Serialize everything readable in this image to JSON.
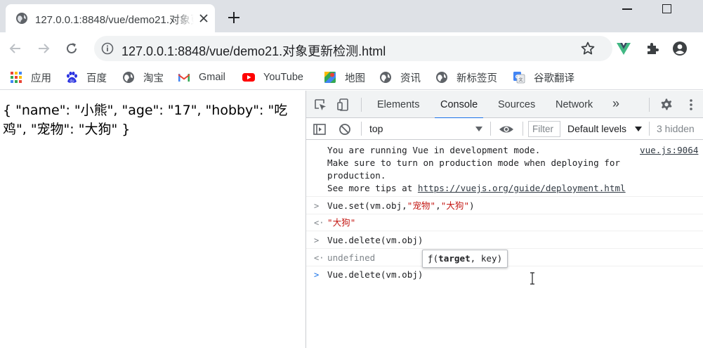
{
  "tab": {
    "title": "127.0.0.1:8848/vue/demo21.对象更新检测.html"
  },
  "omnibox": {
    "url": "127.0.0.1:8848/vue/demo21.对象更新检测.html"
  },
  "bookmarks": [
    {
      "label": "应用",
      "icon": "apps-grid-icon"
    },
    {
      "label": "百度",
      "icon": "baidu-paw-icon"
    },
    {
      "label": "淘宝",
      "icon": "globe-icon"
    },
    {
      "label": "Gmail",
      "icon": "gmail-icon"
    },
    {
      "label": "YouTube",
      "icon": "youtube-icon"
    },
    {
      "label": "地图",
      "icon": "maps-icon"
    },
    {
      "label": "资讯",
      "icon": "globe-icon"
    },
    {
      "label": "新标签页",
      "icon": "globe-icon"
    },
    {
      "label": "谷歌翻译",
      "icon": "translate-icon"
    }
  ],
  "page": {
    "content": "{ \"name\": \"小熊\", \"age\": \"17\", \"hobby\": \"吃鸡\", \"宠物\": \"大狗\" }"
  },
  "devtools": {
    "tabs": [
      "Elements",
      "Console",
      "Sources",
      "Network"
    ],
    "active_tab": "Console",
    "context": "top",
    "filter_placeholder": "Filter",
    "levels": "Default levels",
    "hidden": "3 hidden",
    "console": {
      "vue_msg_line1": "You are running Vue in development mode.",
      "vue_msg_line2": "Make sure to turn on production mode when deploying for",
      "vue_msg_line3": "production.",
      "vue_msg_line4_prefix": "See more tips at ",
      "vue_msg_link": "https://vuejs.org/guide/deployment.html",
      "vue_msg_source": "vue.js:9064",
      "cmd1_prefix": "Vue.set(vm.obj,",
      "cmd1_arg1": "\"宠物\"",
      "cmd1_comma": ",",
      "cmd1_arg2": "\"大狗\"",
      "cmd1_suffix": ")",
      "result1": "\"大狗\"",
      "cmd2": "Vue.delete(vm.obj)",
      "result2": "undefined",
      "input": "Vue.delete(vm.obj)",
      "tooltip_f": "ƒ(",
      "tooltip_param1": "target",
      "tooltip_rest": ", key)"
    }
  }
}
